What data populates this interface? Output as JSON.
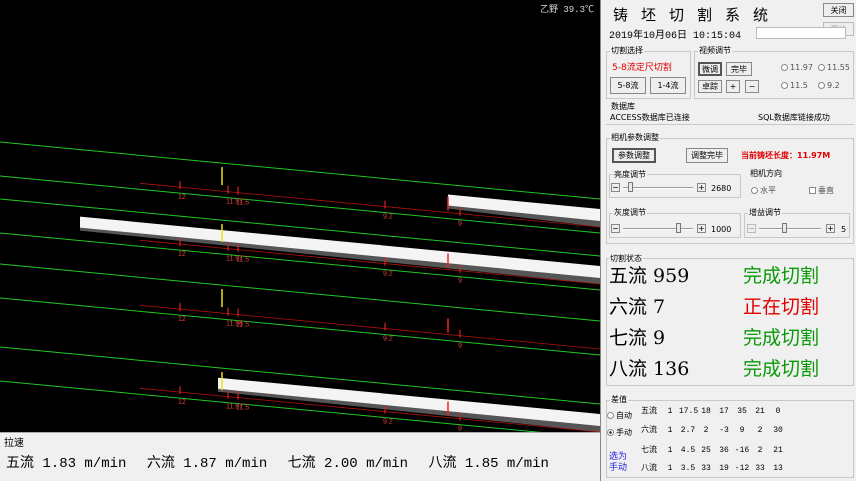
{
  "camera": {
    "status": "乙野 39.3℃",
    "strands": [
      {
        "cut_mark": "11.97",
        "labels": [
          "12",
          "11.97",
          "11.5",
          "9.2",
          "9"
        ]
      },
      {
        "cut_mark": "11.97",
        "labels": [
          "12",
          "11.97",
          "11.5",
          "9.2",
          "9"
        ]
      },
      {
        "cut_mark": "11.96",
        "labels": [
          "12",
          "11.96",
          "11.5",
          "9.2",
          "9"
        ]
      },
      {
        "cut_mark": "11.97",
        "labels": [
          "12",
          "11.97",
          "11.5",
          "9.2",
          "9"
        ]
      }
    ]
  },
  "speed": {
    "title": "拉速",
    "items": [
      "五流  1.83 m/min",
      "六流  1.87 m/min",
      "七流  2.00 m/min",
      "八流  1.85 m/min"
    ]
  },
  "panel": {
    "title": "铸坯切割系统",
    "close_label": "关闭",
    "start_label": "开始",
    "datetime": "2019年10月06日  10:15:04",
    "cut_select": {
      "label": "切割选择",
      "mode_text": "5-8流定尺切割",
      "btn_58": "5-8流",
      "btn_14": "1-4流"
    },
    "video": {
      "label": "视频调节",
      "fine_label": "微调",
      "done_label": "完毕",
      "lock_label": "卓踪",
      "plus": "+",
      "minus": "−",
      "radios": [
        "11.97",
        "11.55",
        "11.5",
        "9.2"
      ]
    },
    "db": {
      "label": "数据库",
      "access": "ACCESS数据库已连接",
      "sql": "SQL数据库链接成功"
    },
    "camera_params": {
      "label": "相机参数调整",
      "adjust_label": "参数调整",
      "done_label": "调整完毕",
      "current_len": "当前铸坯长度：11.97M",
      "brightness_label": "亮度调节",
      "brightness_value": "2680",
      "direction_label": "相机方向",
      "horizontal": "水平",
      "vertical": "垂直",
      "gray_label": "灰度调节",
      "gray_value": "1000",
      "gain_label": "增益调节",
      "gain_value": "5"
    },
    "cut_state": {
      "label": "切割状态",
      "rows": [
        {
          "name": "五流",
          "count": "959",
          "state": "完成切割",
          "color": "#0a9a0a"
        },
        {
          "name": "六流",
          "count": "7",
          "state": "正在切割",
          "color": "#e00000"
        },
        {
          "name": "七流",
          "count": "9",
          "state": "完成切割",
          "color": "#0a9a0a"
        },
        {
          "name": "八流",
          "count": "136",
          "state": "完成切割",
          "color": "#0a9a0a"
        }
      ]
    },
    "diff": {
      "label": "差值",
      "auto": "自动",
      "manual": "手动",
      "selected_hint": "选为\n手动",
      "rows": [
        {
          "name": "五流",
          "values": [
            "1",
            "17.5",
            "18",
            "17",
            "35",
            "21",
            "0"
          ]
        },
        {
          "name": "六流",
          "values": [
            "1",
            "2.7",
            "2",
            "-3",
            "9",
            "2",
            "30"
          ]
        },
        {
          "name": "七流",
          "values": [
            "1",
            "4.5",
            "25",
            "36",
            "-16",
            "2",
            "21"
          ]
        },
        {
          "name": "八流",
          "values": [
            "1",
            "3.5",
            "33",
            "19",
            "-12",
            "33",
            "13"
          ]
        }
      ]
    }
  }
}
